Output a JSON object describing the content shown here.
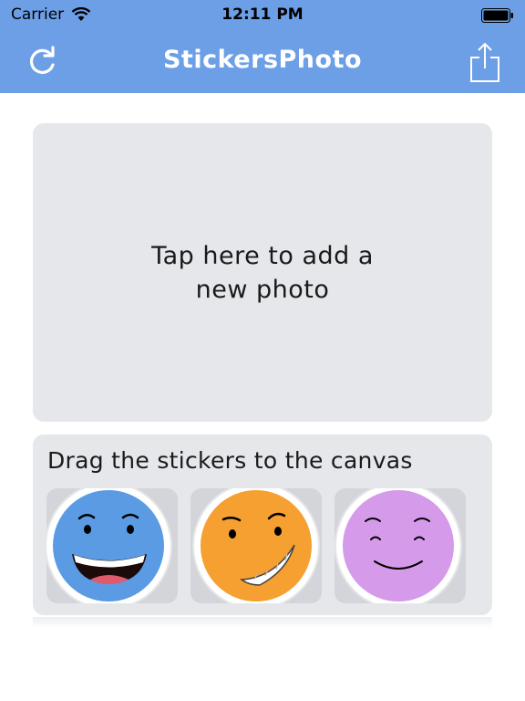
{
  "status_bar": {
    "carrier": "Carrier",
    "time": "12:11 PM",
    "icons": [
      "wifi-icon",
      "battery-icon"
    ]
  },
  "nav": {
    "title": "StickersPhoto",
    "left_button_icon": "refresh-icon",
    "right_button_icon": "share-icon",
    "bar_color": "#6d9fe6"
  },
  "photo_area": {
    "prompt": "Tap here to add a new photo"
  },
  "stickers": {
    "caption": "Drag the stickers to the canvas",
    "items": [
      {
        "name": "laughing-face",
        "color": "#5a9be3"
      },
      {
        "name": "grinning-face",
        "color": "#f5a030"
      },
      {
        "name": "smiling-face",
        "color": "#d59ae9"
      }
    ]
  }
}
